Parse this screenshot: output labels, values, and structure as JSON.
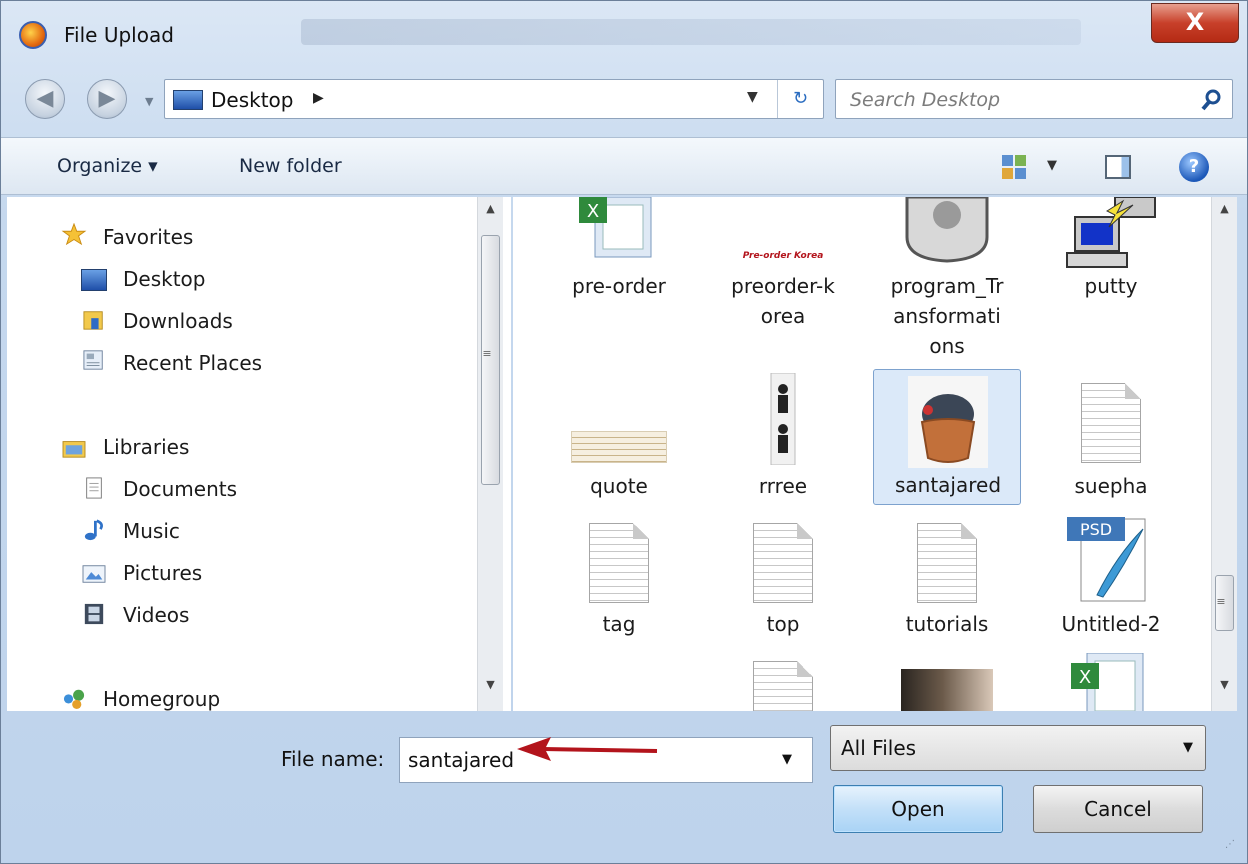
{
  "window": {
    "title": "File Upload",
    "close_symbol": "X"
  },
  "address": {
    "location": "Desktop",
    "search_placeholder": "Search Desktop"
  },
  "toolbar": {
    "organize": "Organize ▾",
    "new_folder": "New folder"
  },
  "nav": {
    "favorites": {
      "label": "Favorites",
      "items": [
        "Desktop",
        "Downloads",
        "Recent Places"
      ]
    },
    "libraries": {
      "label": "Libraries",
      "items": [
        "Documents",
        "Music",
        "Pictures",
        "Videos"
      ]
    },
    "homegroup": "Homegroup"
  },
  "files": {
    "row1": [
      "pre-order",
      "preorder-korea",
      "program_Transformations",
      "putty"
    ],
    "row1_display": [
      "pre-order",
      "preorder-k\norea",
      "program_Tr\nansformati\nons",
      "putty"
    ],
    "preorder_thumb_text": "Pre-order Korea",
    "row2": [
      "quote",
      "rrree",
      "santajared",
      "suepha"
    ],
    "row3": [
      "tag",
      "top",
      "tutorials",
      "Untitled-2"
    ],
    "psd_badge": "PSD",
    "selected": "santajared"
  },
  "footer": {
    "file_name_label": "File name:",
    "file_name_value": "santajared",
    "file_type": "All Files",
    "open_label": "Open",
    "cancel_label": "Cancel"
  },
  "icons": {
    "app": "firefox-icon",
    "back": "back-arrow-icon",
    "forward": "forward-arrow-icon",
    "desktop": "desktop-icon",
    "refresh": "refresh-icon",
    "search": "search-icon",
    "views": "view-options-icon",
    "preview": "preview-pane-icon",
    "help": "help-icon"
  },
  "colors": {
    "selection": "#dbe9f9",
    "arrow": "#b3141c",
    "open_border": "#3c7fb1"
  }
}
